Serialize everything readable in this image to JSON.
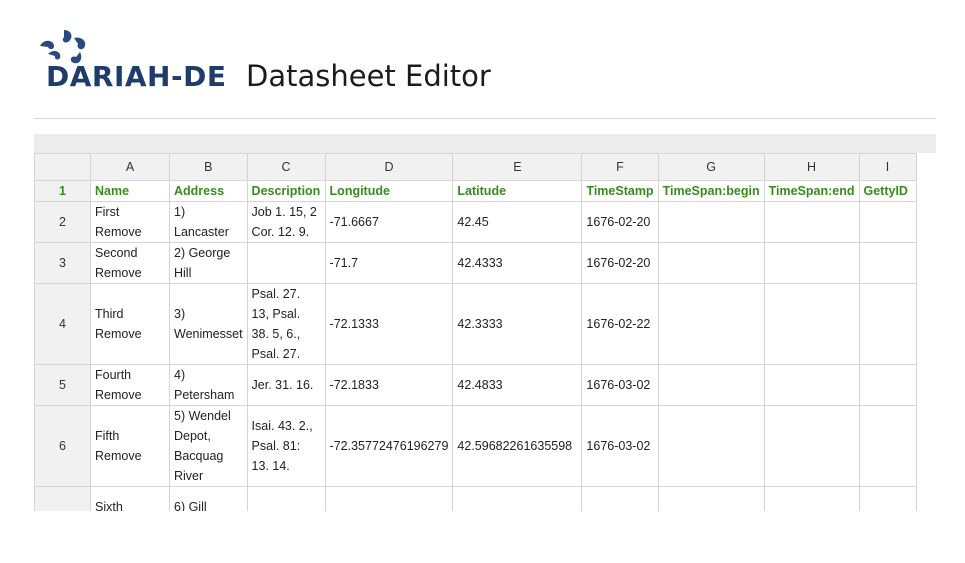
{
  "header": {
    "brand": "DARIAH-DE",
    "title": "Datasheet Editor",
    "colors": {
      "brand": "#1f3d6b",
      "brand_accent": "#2a4a7e",
      "header_text": "#3b8a1e"
    }
  },
  "grid": {
    "columns": [
      "A",
      "B",
      "C",
      "D",
      "E",
      "F",
      "G",
      "H",
      "I"
    ],
    "rows": [
      {
        "num": "1",
        "header": true,
        "cells": [
          "Name",
          "Address",
          "Description",
          "Longitude",
          "Latitude",
          "TimeStamp",
          "TimeSpan:begin",
          "TimeSpan:end",
          "GettyID"
        ]
      },
      {
        "num": "2",
        "cells": [
          "First Remove",
          "1) Lancaster",
          "Job 1. 15, 2 Cor. 12. 9.",
          "-71.6667",
          "42.45",
          "1676-02-20",
          "",
          "",
          ""
        ]
      },
      {
        "num": "3",
        "cells": [
          "Second Remove",
          "2) George Hill",
          "",
          "-71.7",
          "42.4333",
          "1676-02-20",
          "",
          "",
          ""
        ]
      },
      {
        "num": "4",
        "cells": [
          "Third Remove",
          "3) Wenimesset",
          "Psal. 27. 13, Psal. 38. 5, 6., Psal. 27.",
          "-72.1333",
          "42.3333",
          "1676-02-22",
          "",
          "",
          ""
        ]
      },
      {
        "num": "5",
        "cells": [
          "Fourth Remove",
          "4) Petersham",
          "Jer. 31. 16.",
          "-72.1833",
          "42.4833",
          "1676-03-02",
          "",
          "",
          ""
        ]
      },
      {
        "num": "6",
        "cells": [
          "Fifth Remove",
          "5) Wendel Depot, Bacquag River",
          "Isai. 43. 2., Psal. 81: 13. 14.",
          "-72.35772476196279",
          "42.59682261635598",
          "1676-03-02",
          "",
          "",
          ""
        ]
      },
      {
        "num": "",
        "cells": [
          "Sixth",
          "6) Gill",
          "",
          "",
          "",
          "",
          "",
          "",
          ""
        ]
      }
    ]
  }
}
